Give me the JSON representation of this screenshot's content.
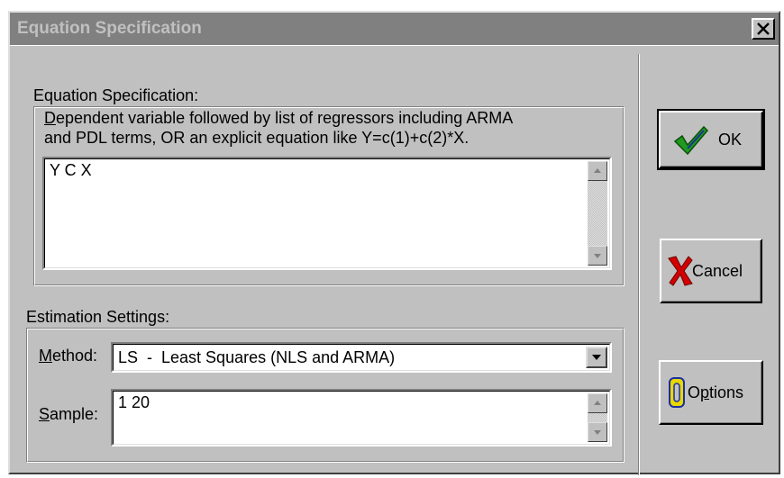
{
  "dialog": {
    "title": "Equation Specification",
    "close_glyph": "✕"
  },
  "equation": {
    "group_label": "Equation Specification:",
    "help_line1_accel": "D",
    "help_line1_rest": "ependent variable followed by list of regressors including ARMA",
    "help_line2": "and PDL terms, OR an explicit equation like Y=c(1)+c(2)*X.",
    "value": "Y C X"
  },
  "estimation": {
    "group_label": "Estimation Settings:",
    "method_label_accel": "M",
    "method_label_rest": "ethod:",
    "method_value": "LS  -  Least Squares (NLS and ARMA)",
    "sample_label_accel": "S",
    "sample_label_rest": "ample:",
    "sample_value": "1 20"
  },
  "buttons": {
    "ok_label": "OK",
    "cancel_label": "Cancel",
    "options_prefix": "O",
    "options_accel": "p",
    "options_rest": "tions"
  },
  "icons": {
    "ok": "checkmark-icon",
    "cancel": "x-mark-icon",
    "options": "options-o-icon",
    "close": "close-icon",
    "scroll_up": "scroll-up-arrow-icon",
    "scroll_down": "scroll-down-arrow-icon",
    "dropdown": "dropdown-arrow-icon"
  },
  "colors": {
    "titlebar_inactive": "#808080",
    "face": "#c0c0c0",
    "ok_check_green": "#1f9a1f",
    "cancel_x_red": "#d40000",
    "options_o_yellow": "#e8d800"
  }
}
